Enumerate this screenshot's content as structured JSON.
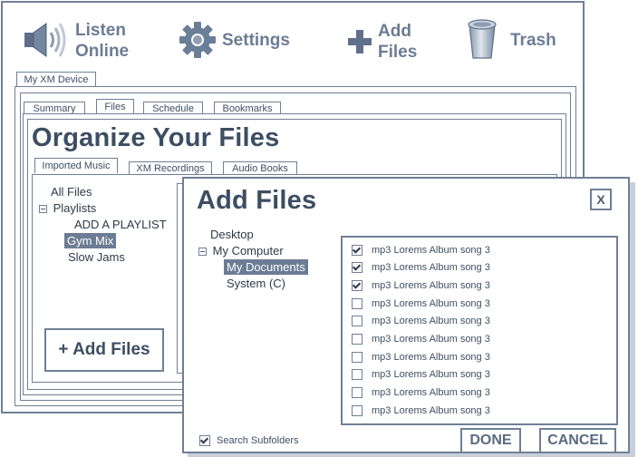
{
  "toolbar": {
    "listen_line1": "Listen",
    "listen_line2": "Online",
    "settings": "Settings",
    "add_files_line1": "Add",
    "add_files_line2": "Files",
    "trash": "Trash"
  },
  "device_tab": "My XM Device",
  "tabs": [
    "Summary",
    "Files",
    "Schedule",
    "Bookmarks"
  ],
  "page_title": "Organize Your Files",
  "subtabs": [
    "Imported Music",
    "XM Recordings",
    "Audio Books"
  ],
  "tree": {
    "all_files": "All Files",
    "playlists": "Playlists",
    "add_playlist": "ADD A PLAYLIST",
    "gym_mix": "Gym Mix",
    "slow_jams": "Slow Jams"
  },
  "add_files_button": "+ Add Files",
  "dialog": {
    "title": "Add Files",
    "close": "X",
    "locations": {
      "desktop": "Desktop",
      "my_computer": "My Computer",
      "my_documents": "My Documents",
      "system": "System (C)"
    },
    "files": [
      {
        "name": "mp3 Lorems Album song 3",
        "checked": true
      },
      {
        "name": "mp3 Lorems Album song 3",
        "checked": true
      },
      {
        "name": "mp3 Lorems Album song 3",
        "checked": true
      },
      {
        "name": "mp3 Lorems Album song 3",
        "checked": false
      },
      {
        "name": "mp3 Lorems Album song 3",
        "checked": false
      },
      {
        "name": "mp3 Lorems Album song 3",
        "checked": false
      },
      {
        "name": "mp3 Lorems Album song 3",
        "checked": false
      },
      {
        "name": "mp3 Lorems Album song 3",
        "checked": false
      },
      {
        "name": "mp3 Lorems Album song 3",
        "checked": false
      },
      {
        "name": "mp3 Lorems Album song 3",
        "checked": false
      }
    ],
    "search_subfolders": "Search Subfolders",
    "search_subfolders_checked": true,
    "done": "DONE",
    "cancel": "CANCEL"
  }
}
